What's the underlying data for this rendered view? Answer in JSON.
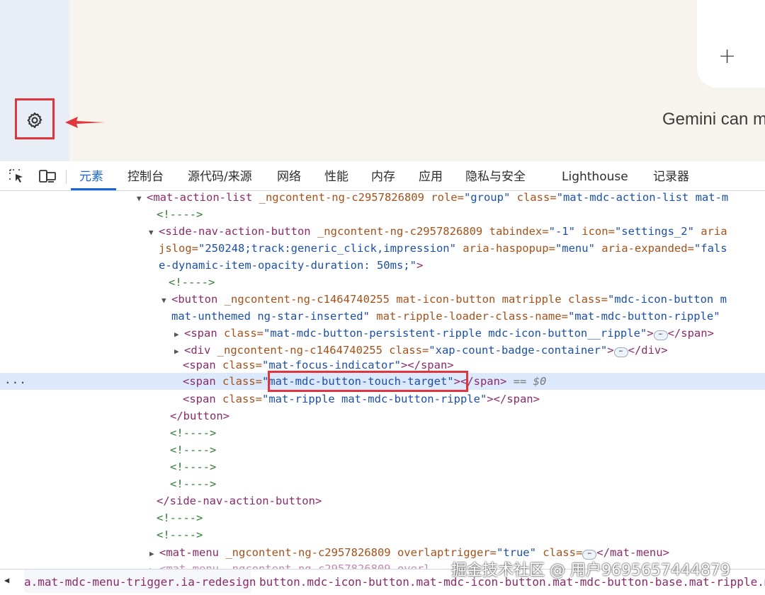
{
  "app": {
    "gemini_text": "Gemini can m",
    "plus_label": "+",
    "gear_icon": "settings-gear-icon"
  },
  "devtools": {
    "tabs": [
      "元素",
      "控制台",
      "源代码/来源",
      "网络",
      "性能",
      "内存",
      "应用",
      "隐私与安全",
      "Lighthouse",
      "记录器"
    ],
    "active_tab": "元素"
  },
  "code_lines": {
    "l1_tag": "<mat-action-list",
    "l1_a1": " _ngcontent-ng-c2957826809",
    "l1_a2": " role=",
    "l1_v2": "\"group\"",
    "l1_a3": " class=",
    "l1_v3": "\"mat-mdc-action-list mat-m",
    "comment": "<!---->",
    "l3_tag": "<side-nav-action-button",
    "l3_a1": " _ngcontent-ng-c2957826809",
    "l3_a2": " tabindex=",
    "l3_v2": "\"-1\"",
    "l3_a3": " icon=",
    "l3_v3": "\"settings_2\"",
    "l3_a4": " aria",
    "l4_a1": "jslog=",
    "l4_v1": "\"250248;track:generic_click,impression\"",
    "l4_a2": " aria-haspopup=",
    "l4_v2": "\"menu\"",
    "l4_a3": " aria-expanded=",
    "l4_v3": "\"fals",
    "l5_v": "e-dynamic-item-opacity-duration: 50ms;\"",
    "l5_close": ">",
    "l7_tag": "<button",
    "l7_a1": " _ngcontent-ng-c1464740255",
    "l7_a2": " mat-icon-button",
    "l7_a3": " matripple",
    "l7_a4": " class=",
    "l7_v4": "\"mdc-icon-button m",
    "l8_v": "mat-unthemed ng-star-inserted\"",
    "l8_a": " mat-ripple-loader-class-name=",
    "l8_v2": "\"mat-mdc-button-ripple\"",
    "l9_tag": "<span",
    "l9_a": " class=",
    "l9_v": "\"mat-mdc-button-persistent-ripple mdc-icon-button__ripple\"",
    "l9_close": ">",
    "l9_end": "</span>",
    "l10_tag": "<div",
    "l10_a1": " _ngcontent-ng-c1464740255",
    "l10_a2": " class=",
    "l10_v2": "\"xap-count-badge-container\"",
    "l10_close": ">",
    "l10_end": "</div>",
    "l11_tag": "<span",
    "l11_a": " class=",
    "l11_v": "\"mat-focus-indicator\"",
    "l11_end": "></span>",
    "l12_tag": "<span",
    "l12_a": " class=",
    "l12_v": "\"mat-mdc-button-touch-target\"",
    "l12_end": "></span>",
    "l12_eq": " == ",
    "l12_dollar": "$0",
    "l13_tag": "<span",
    "l13_a": " class=",
    "l13_v": "\"mat-ripple mat-mdc-button-ripple\"",
    "l13_end": "></span>",
    "l14_tag": "</button>",
    "l19_tag": "</side-nav-action-button>",
    "l22_tag": "<mat-menu",
    "l22_a1": " _ngcontent-ng-c2957826809",
    "l22_a2": " overlaptrigger=",
    "l22_v2": "\"true\"",
    "l22_a3": " class=",
    "l22_end": "</mat-menu>",
    "l23_text": "<mat-menu _ngcontent-ng-c2957826809 overl",
    "ellipsis": "⋯",
    "row_dots": "..."
  },
  "breadcrumb": {
    "item1": "a.mat-mdc-menu-trigger.ia-redesign",
    "item2": "button.mdc-icon-button.mat-mdc-icon-button.mat-mdc-button-base.mat-ripple.ma"
  },
  "watermark": "掘金技术社区 @ 用户9695657444879",
  "colors": {
    "highlight": "#e0353c",
    "active_tab": "#1a66d8",
    "selected_row": "#dce8fb"
  }
}
